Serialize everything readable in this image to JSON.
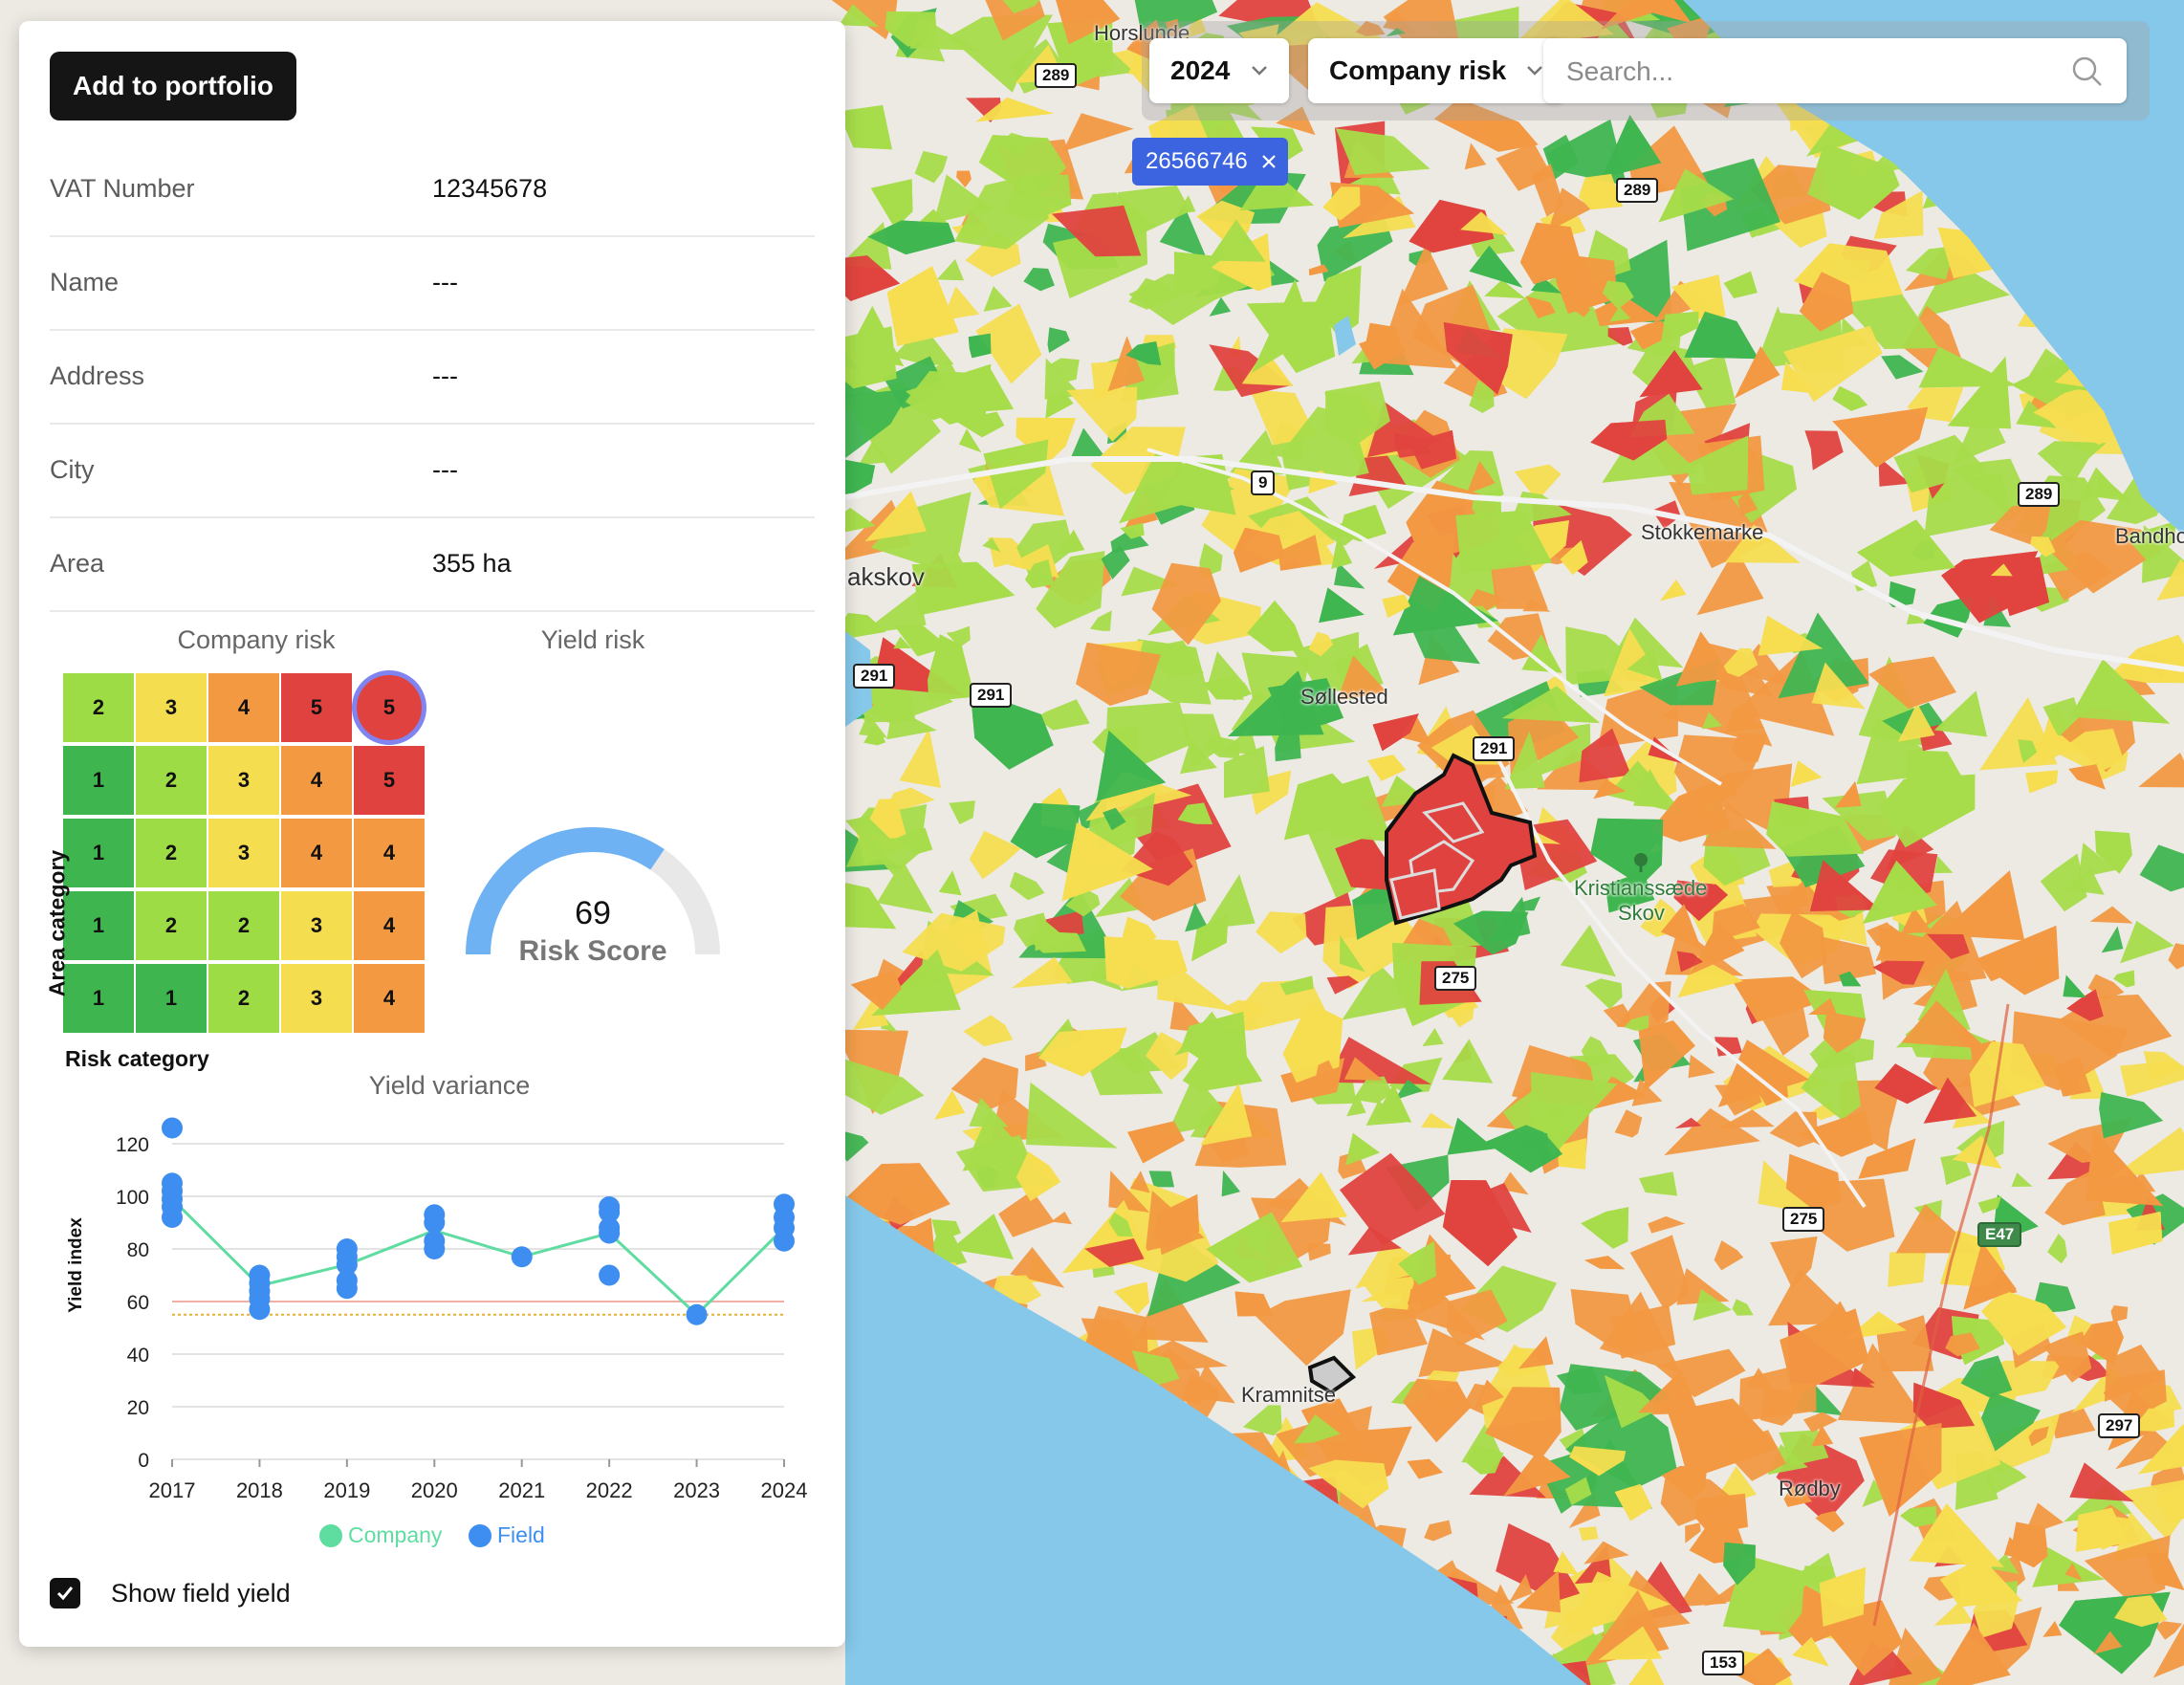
{
  "panel": {
    "add_button": "Add to portfolio",
    "info": [
      {
        "label": "VAT Number",
        "value": "12345678"
      },
      {
        "label": "Name",
        "value": "---"
      },
      {
        "label": "Address",
        "value": "---"
      },
      {
        "label": "City",
        "value": "---"
      },
      {
        "label": "Area",
        "value": "355 ha"
      }
    ],
    "company_risk": {
      "title": "Company risk",
      "y_axis_label": "Area category",
      "x_axis_label": "Risk category",
      "matrix": [
        [
          2,
          3,
          4,
          5,
          5
        ],
        [
          1,
          2,
          3,
          4,
          5
        ],
        [
          1,
          2,
          3,
          4,
          4
        ],
        [
          1,
          2,
          2,
          3,
          4
        ],
        [
          1,
          1,
          2,
          3,
          4
        ]
      ],
      "highlight": {
        "row": 0,
        "col": 4
      }
    },
    "yield_risk": {
      "title": "Yield risk",
      "score": "69",
      "score_label": "Risk Score",
      "fraction": 0.69
    },
    "show_field_yield": {
      "label": "Show field yield",
      "checked": true
    }
  },
  "chart_data": {
    "type": "line",
    "title": "Yield variance",
    "ylabel": "Yield index",
    "xlabel": "",
    "ylim": [
      0,
      120
    ],
    "yticks": [
      0,
      20,
      40,
      60,
      80,
      100,
      120
    ],
    "x": [
      "2017",
      "2018",
      "2019",
      "2020",
      "2021",
      "2022",
      "2023",
      "2024"
    ],
    "series": [
      {
        "name": "Company",
        "kind": "line",
        "color": "#5fdca0",
        "values": [
          99,
          66,
          74,
          87,
          77,
          86,
          55,
          88
        ]
      },
      {
        "name": "Field",
        "kind": "scatter",
        "color": "#3d8ef0",
        "points": [
          [
            2017,
            126
          ],
          [
            2017,
            105
          ],
          [
            2017,
            102
          ],
          [
            2017,
            99
          ],
          [
            2017,
            96
          ],
          [
            2017,
            92
          ],
          [
            2018,
            70
          ],
          [
            2018,
            67
          ],
          [
            2018,
            64
          ],
          [
            2018,
            61
          ],
          [
            2018,
            57
          ],
          [
            2019,
            80
          ],
          [
            2019,
            77
          ],
          [
            2019,
            74
          ],
          [
            2019,
            68
          ],
          [
            2019,
            65
          ],
          [
            2020,
            93
          ],
          [
            2020,
            90
          ],
          [
            2020,
            83
          ],
          [
            2020,
            80
          ],
          [
            2021,
            77
          ],
          [
            2022,
            96
          ],
          [
            2022,
            94
          ],
          [
            2022,
            88
          ],
          [
            2022,
            86
          ],
          [
            2022,
            70
          ],
          [
            2023,
            55
          ],
          [
            2024,
            97
          ],
          [
            2024,
            92
          ],
          [
            2024,
            88
          ],
          [
            2024,
            83
          ]
        ]
      }
    ],
    "reference_lines": [
      {
        "value": 60,
        "color": "#f0b0a8",
        "style": "solid"
      },
      {
        "value": 55,
        "color": "#e8b030",
        "style": "dotted"
      }
    ],
    "legend": [
      "Company",
      "Field"
    ]
  },
  "toolbar": {
    "year": "2024",
    "layer": "Company risk",
    "search_placeholder": "Search...",
    "chip": "26566746"
  },
  "map": {
    "places": [
      "Horslunde",
      "akskov",
      "Søllested",
      "Kristianssæde",
      "Skov",
      "Stokkemarke",
      "Bandho",
      "Kramnitse",
      "Rødby"
    ],
    "roads": [
      "289",
      "289",
      "289",
      "9",
      "291",
      "291",
      "291",
      "275",
      "275",
      "E47",
      "297",
      "153"
    ]
  },
  "colors": {
    "risk": [
      "#3fb550",
      "#9edc45",
      "#f5dd50",
      "#f29942",
      "#e0433f"
    ],
    "water": "#86c8ea",
    "land": "#ede9e3"
  }
}
